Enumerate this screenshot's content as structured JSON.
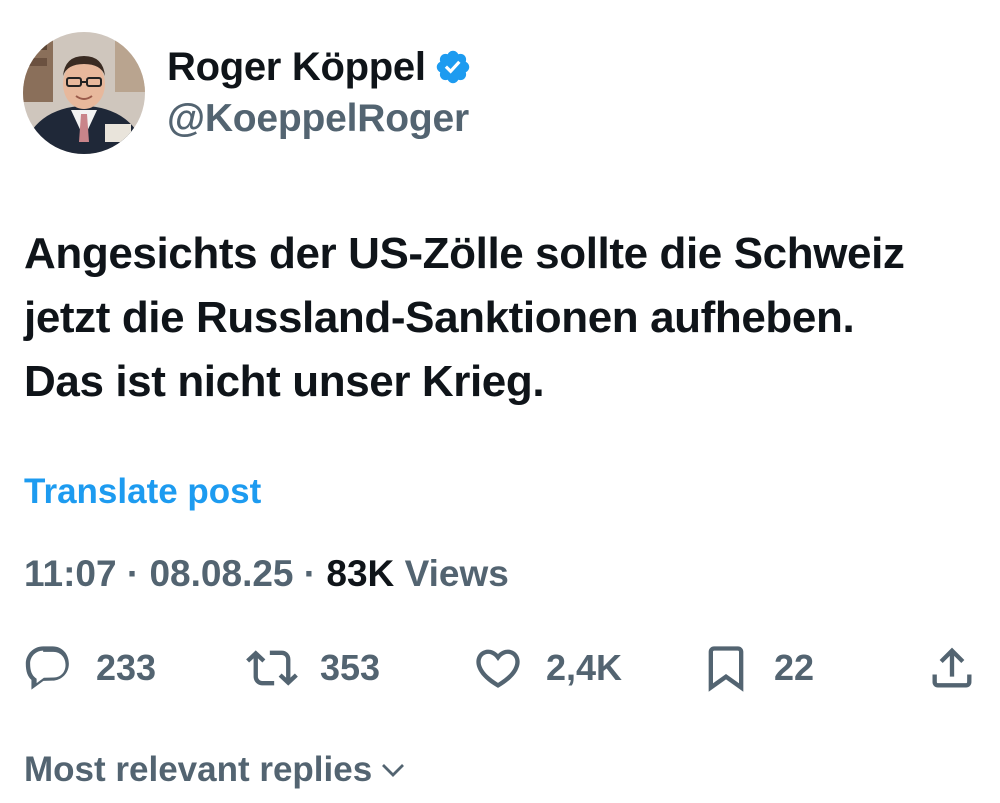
{
  "author": {
    "display_name": "Roger Köppel",
    "handle": "@KoeppelRoger"
  },
  "post": {
    "lines": [
      "Angesichts der US-Zölle sollte die Schweiz",
      "jetzt die Russland-Sanktionen aufheben.",
      "Das ist nicht unser Krieg."
    ],
    "translate_label": "Translate post"
  },
  "meta": {
    "time": "11:07",
    "separator": " · ",
    "date": "08.08.25",
    "views_count": "83K",
    "views_label": " Views"
  },
  "actions": {
    "replies": "233",
    "reposts": "353",
    "likes": "2,4K",
    "bookmarks": "22"
  },
  "replies_sort": {
    "label": "Most relevant replies"
  },
  "colors": {
    "text": "#0f1419",
    "secondary": "#536471",
    "accent": "#1d9bf0"
  }
}
